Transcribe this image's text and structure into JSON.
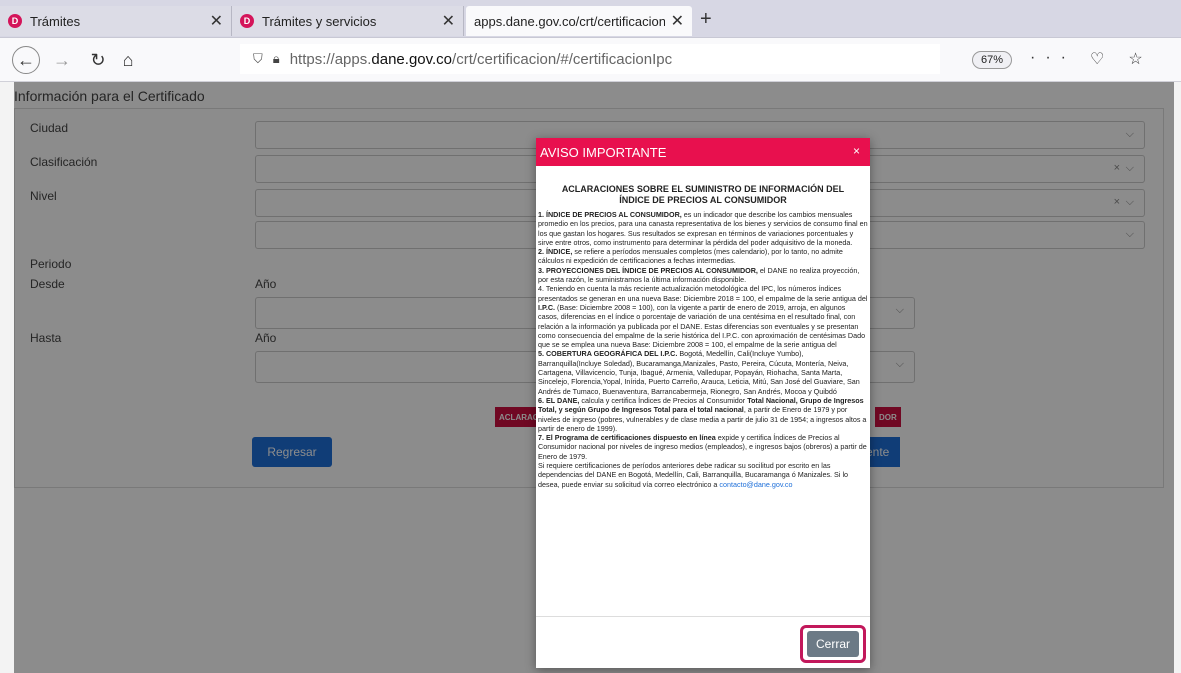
{
  "browser": {
    "tabs": [
      {
        "label": "Trámites",
        "favicon": "D"
      },
      {
        "label": "Trámites y servicios",
        "favicon": "D"
      },
      {
        "label": "apps.dane.gov.co/crt/certificacion"
      }
    ],
    "url_prefix": "https://apps.",
    "url_host": "dane.gov.co",
    "url_path": "/crt/certificacion/#/certificacionIpc",
    "zoom": "67%"
  },
  "form": {
    "section_title": "Información para el Certificado",
    "labels": {
      "ciudad": "Ciudad",
      "clasificacion": "Clasificación",
      "nivel": "Nivel",
      "periodo": "Periodo",
      "desde": "Desde",
      "hasta": "Hasta",
      "anio_desde": "Año",
      "anio_hasta": "Año"
    },
    "buttons": {
      "regresar": "Regresar",
      "aclaraciones": "ACLARAC",
      "red_right": "DOR",
      "blue_right": "ente"
    }
  },
  "modal": {
    "title": "AVISO IMPORTANTE",
    "heading_line1": "ACLARACIONES SOBRE EL SUMINISTRO DE INFORMACIÓN DEL",
    "heading_line2": "ÍNDICE DE PRECIOS AL CONSUMIDOR",
    "p1_bold": "1. ÍNDICE DE PRECIOS AL CONSUMIDOR,",
    "p1_text": " es un indicador que describe los cambios mensuales promedio en los precios, para una canasta representativa de los bienes y servicios de consumo final en los que gastan los hogares. Sus resultados se expresan en términos de variaciones porcentuales y sirve entre otros, como instrumento para determinar la pérdida del poder adquisitivo de la moneda.",
    "p2_bold": "2. ÍNDICE,",
    "p2_text": " se refiere a períodos mensuales completos (mes calendario), por lo tanto, no admite cálculos ni expedición de certificaciones a fechas intermedias.",
    "p3_bold": "3. PROYECCIONES DEL ÍNDICE DE PRECIOS AL CONSUMIDOR,",
    "p3_text": " el DANE no realiza proyección, por esta razón, le suministramos la última información disponible.",
    "p4_text_a": "4. Teniendo en cuenta la más reciente actualización metodológica del IPC, los números índices presentados se generan en una nueva Base: Diciembre 2018 = 100, el empalme de la serie antigua del ",
    "p4_bold_a": "I.P.C.",
    "p4_text_b": " (Base: Diciembre 2008 = 100), con la vigente a partir de enero de 2019, arroja, en algunos casos, diferencias en el índice o porcentaje de variación de una centésima en el resultado final, con relación a la información ya publicada por el DANE. Estas diferencias son eventuales y se presentan como consecuencia del empalme de la serie histórica del I.P.C. con aproximación de centésimas Dado que se se emplea una nueva Base: Diciembre 2008 = 100, el empalme de la serie antigua del",
    "p5_bold": "5. COBERTURA GEOGRÁFICA DEL I.P.C.",
    "p5_text": " Bogotá, Medellín, Cali(Incluye Yumbo), Barranquilla(Incluye Soledad), Bucaramanga,Manizales, Pasto, Pereira, Cúcuta, Montería, Neiva, Cartagena, Villavicencio, Tunja, Ibagué, Armenia, Valledupar, Popayán, Riohacha, Santa Marta, Sincelejo, Florencia,Yopal, Inírida, Puerto Carreño, Arauca, Leticia, Mitú, San José del Guaviare, San Andrés de Tumaco, Buenaventura, Barrancabermeja, Rionegro, San Andrés, Mocoa y Quibdó",
    "p6_bold_a": "6. EL DANE,",
    "p6_text_a": " calcula y certifica Índices de Precios al Consumidor ",
    "p6_bold_b": "Total Nacional, Grupo de Ingresos Total, y según Grupo de Ingresos Total para el total nacional",
    "p6_text_b": ", a partir de Enero de 1979 y por niveles de ingreso (pobres, vulnerables y de clase media a partir de julio 31 de 1954; a ingresos altos a partir de enero de 1999).",
    "p7_bold": "7. El Programa de certificaciones dispuesto en línea",
    "p7_text": " expide y certifica Índices de Precios al Consumidor nacional por niveles de ingreso medios (empleados), e ingresos bajos (obreros) a partir de Enero de 1979.",
    "p8_text": "Si requiere certificaciones de períodos anteriores debe radicar su socilitud por escrito en las dependencias del DANE en Bogotá, Medellín, Cali, Barranquilla, Bucaramanga ó Manizales. Si lo desea, puede enviar su solicitud vía correo electrónico a ",
    "p8_link": "contacto@dane.gov.co",
    "close_label": "Cerrar",
    "close_x": "×"
  },
  "colors": {
    "modal_header": "#e8104e",
    "primary_button": "#1e6fd9",
    "close_button": "#6c7a86",
    "highlight_ring": "#c2185b"
  }
}
